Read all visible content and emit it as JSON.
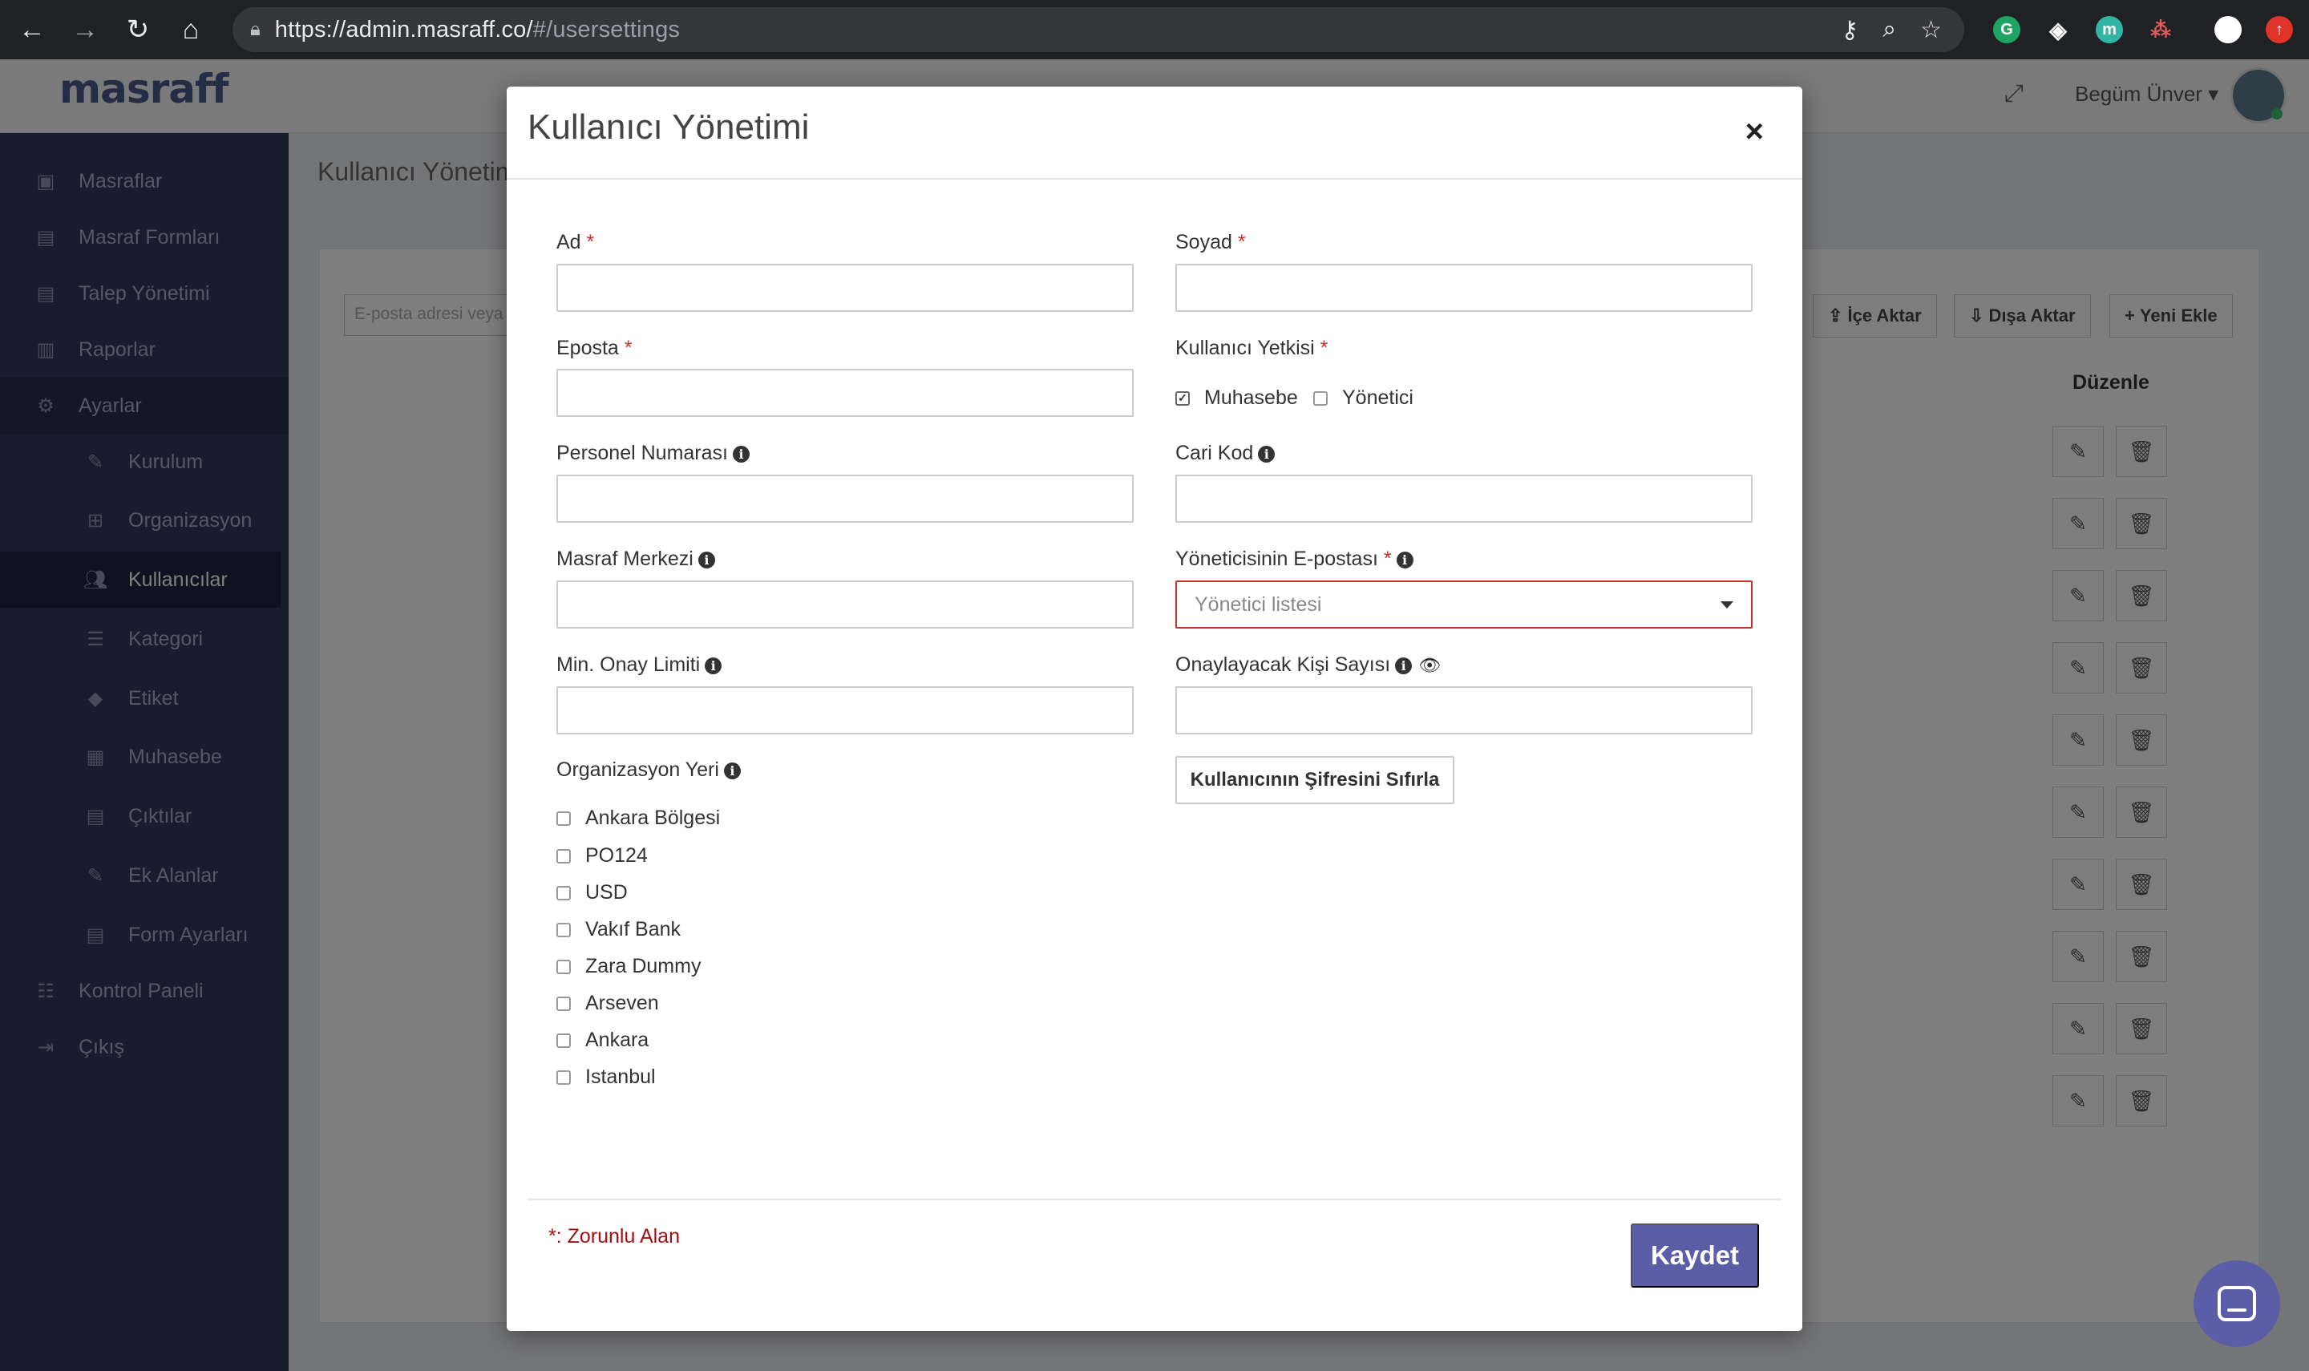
{
  "browser": {
    "url_host": "https://admin.masraff.co/",
    "url_path": "#/usersettings",
    "extension_colors": [
      "#1fa463",
      "#4a6cf7",
      "#33b5a5",
      "#e05a5a",
      "#ffffff",
      "#e0332a"
    ]
  },
  "app": {
    "logo": "masraff",
    "user_name": "Begüm Ünver ▾",
    "page_title": "Kullanıcı Yönetim",
    "search_placeholder": "E-posta adresi veya",
    "actions": {
      "import": "İçe Aktar",
      "export": "Dışa Aktar",
      "add_new": "Yeni Ekle"
    },
    "table_edit_header": "Düzenle",
    "sidebar": {
      "items": [
        {
          "label": "Masraflar",
          "icon": "money-icon"
        },
        {
          "label": "Masraf Formları",
          "icon": "file-icon"
        },
        {
          "label": "Talep Yönetimi",
          "icon": "file-icon"
        },
        {
          "label": "Raporlar",
          "icon": "bar-chart-icon"
        },
        {
          "label": "Ayarlar",
          "icon": "gear-icon"
        },
        {
          "label": "Kurulum",
          "icon": "wrench-icon"
        },
        {
          "label": "Organizasyon",
          "icon": "sitemap-icon"
        },
        {
          "label": "Kullanıcılar",
          "icon": "users-icon"
        },
        {
          "label": "Kategori",
          "icon": "list-icon"
        },
        {
          "label": "Etiket",
          "icon": "tags-icon"
        },
        {
          "label": "Muhasebe",
          "icon": "calculator-icon"
        },
        {
          "label": "Çıktılar",
          "icon": "file-icon"
        },
        {
          "label": "Ek Alanlar",
          "icon": "pencil-icon"
        },
        {
          "label": "Form Ayarları",
          "icon": "file-icon"
        },
        {
          "label": "Kontrol Paneli",
          "icon": "sliders-icon"
        },
        {
          "label": "Çıkış",
          "icon": "sign-out-icon"
        }
      ]
    }
  },
  "modal": {
    "title": "Kullanıcı Yönetimi",
    "close": "×",
    "fields": {
      "first_name": {
        "label": "Ad",
        "required": "*",
        "value": ""
      },
      "last_name": {
        "label": "Soyad",
        "required": "*",
        "value": ""
      },
      "email": {
        "label": "Eposta",
        "required": "*",
        "value": ""
      },
      "permission": {
        "label": "Kullanıcı Yetkisi",
        "required": "*"
      },
      "employee_number": {
        "label": "Personel Numarası",
        "value": ""
      },
      "account_code": {
        "label": "Cari Kod",
        "value": ""
      },
      "cost_center": {
        "label": "Masraf Merkezi",
        "value": ""
      },
      "manager_email": {
        "label": "Yöneticisinin E-postası",
        "required": "*",
        "placeholder": "Yönetici listesi"
      },
      "min_approval_limit": {
        "label": "Min. Onay Limiti",
        "value": ""
      },
      "approver_count": {
        "label": "Onaylayacak Kişi Sayısı",
        "value": ""
      },
      "organization_place": {
        "label": "Organizasyon Yeri"
      }
    },
    "permissions": [
      {
        "label": "Muhasebe",
        "checked": true
      },
      {
        "label": "Yönetici",
        "checked": false
      }
    ],
    "organizations": [
      {
        "label": "Ankara Bölgesi",
        "checked": false
      },
      {
        "label": "PO124",
        "checked": false
      },
      {
        "label": "USD",
        "checked": false
      },
      {
        "label": "Vakıf Bank",
        "checked": false
      },
      {
        "label": "Zara Dummy",
        "checked": false
      },
      {
        "label": "Arseven",
        "checked": false
      },
      {
        "label": "Ankara",
        "checked": false
      },
      {
        "label": "Istanbul",
        "checked": false
      }
    ],
    "reset_password_button": "Kullanıcının Şifresini Sıfırla",
    "required_note": "*: Zorunlu Alan",
    "save_button": "Kaydet"
  },
  "colors": {
    "primary": "#5b5ea6",
    "required": "#c9302c",
    "sidebar": "#2f3a5e"
  }
}
